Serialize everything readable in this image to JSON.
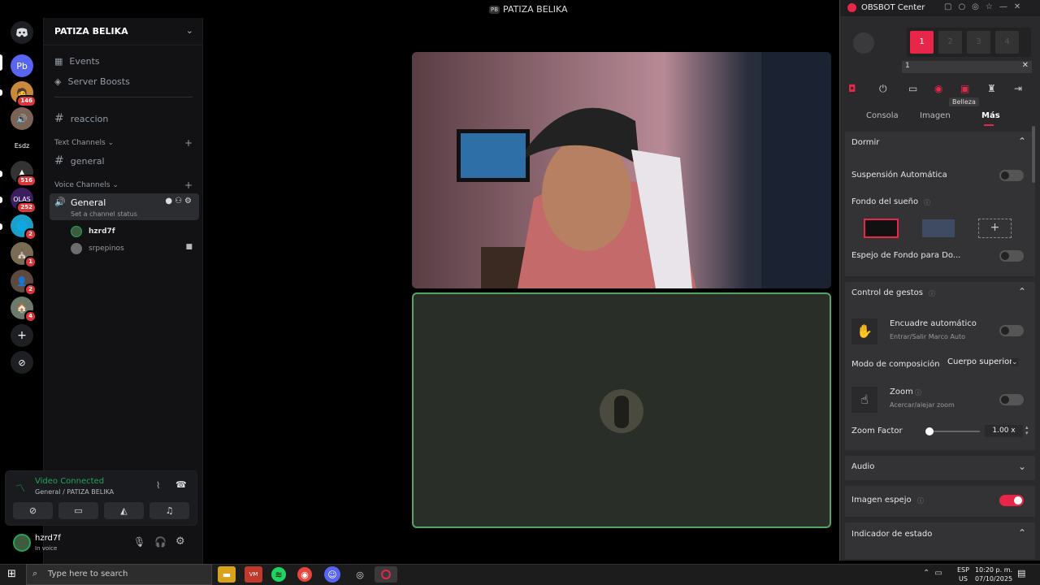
{
  "top_title": "PATIZA BELIKA",
  "top_badge": "PB",
  "servers": [
    {
      "label": "Pb",
      "color": "#5865f2",
      "badge": ""
    },
    {
      "label": "🧑",
      "color": "#c98a3a",
      "badge": "146"
    },
    {
      "label": "🔊",
      "color": "#7b6455",
      "badge": ""
    },
    {
      "label": "Esdz",
      "color": "#000000",
      "badge": ""
    },
    {
      "label": "▲",
      "color": "#333333",
      "badge": "516"
    },
    {
      "label": "OLAS",
      "color": "#3b1e5f",
      "badge": "252"
    },
    {
      "label": "🌐",
      "color": "#1aa0c8",
      "badge": "2"
    },
    {
      "label": "⛪",
      "color": "#7a6b55",
      "badge": "1"
    },
    {
      "label": "👤",
      "color": "#5b4a3d",
      "badge": "2"
    },
    {
      "label": "🏠",
      "color": "#6b7a6a",
      "badge": "4"
    }
  ],
  "channel_panel": {
    "server_name": "PATIZA BELIKA",
    "events": "Events",
    "boosts": "Server Boosts",
    "reaccion": "reaccion",
    "text_category": "Text Channels",
    "general_text": "general",
    "voice_category": "Voice Channels",
    "general_voice": "General",
    "status_hint": "Set a channel status",
    "voice_users": [
      "hzrd7f",
      "srpepinos"
    ]
  },
  "voice_status": {
    "connected": "Video Connected",
    "location": "General / PATIZA BELIKA"
  },
  "user": {
    "name": "hzrd7f",
    "status": "In voice"
  },
  "obsbot": {
    "title": "OBSBOT Center",
    "presets": [
      "1",
      "2",
      "3",
      "4"
    ],
    "preset_label": "1",
    "tooltip": "Belleza",
    "tabs": [
      "Consola",
      "Imagen",
      "Más"
    ],
    "active_tab": "Más",
    "dormir": "Dormir",
    "suspension": "Suspensión Automática",
    "fondo_sueno": "Fondo del sueño",
    "espejo_fondo": "Espejo de Fondo para Do...",
    "control_gestos": "Control de gestos",
    "encuadre": "Encuadre automático",
    "encuadre_sub": "Entrar/Salir Marco Auto",
    "modo_comp": "Modo de composición",
    "modo_value": "Cuerpo superior",
    "zoom": "Zoom",
    "zoom_sub": "Acercar/alejar zoom",
    "zoom_factor": "Zoom Factor",
    "zoom_value": "1.00 x",
    "zoom_slider_level": 0.0,
    "audio": "Audio",
    "imagen_espejo": "Imagen espejo",
    "indicador": "Indicador de estado",
    "accent": "#e8264a"
  },
  "taskbar": {
    "search_placeholder": "Type here to search",
    "lang1": "ESP",
    "lang2": "US",
    "time": "10:20 p. m.",
    "date": "07/10/2025"
  }
}
